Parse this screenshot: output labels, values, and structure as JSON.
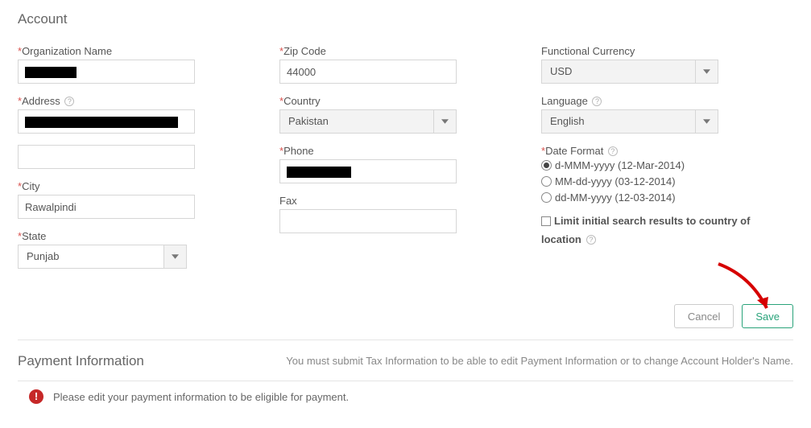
{
  "section_title": "Account",
  "col1": {
    "org_label": "Organization Name",
    "addr_label": "Address",
    "city_label": "City",
    "city_value": "Rawalpindi",
    "state_label": "State",
    "state_value": "Punjab"
  },
  "col2": {
    "zip_label": "Zip Code",
    "zip_value": "44000",
    "country_label": "Country",
    "country_value": "Pakistan",
    "phone_label": "Phone",
    "fax_label": "Fax"
  },
  "col3": {
    "currency_label": "Functional Currency",
    "currency_value": "USD",
    "language_label": "Language",
    "language_value": "English",
    "dateformat_label": "Date Format",
    "opt1": "d-MMM-yyyy (12-Mar-2014)",
    "opt2": "MM-dd-yyyy (03-12-2014)",
    "opt3": "dd-MM-yyyy (12-03-2014)",
    "limit_label_a": "Limit initial search results to country of",
    "limit_label_b": "location"
  },
  "buttons": {
    "cancel": "Cancel",
    "save": "Save"
  },
  "payment": {
    "title": "Payment Information",
    "msg": "You must submit Tax Information to be able to edit Payment Information or to change Account Holder's Name.",
    "alert": "Please edit your payment information to be eligible for payment."
  }
}
